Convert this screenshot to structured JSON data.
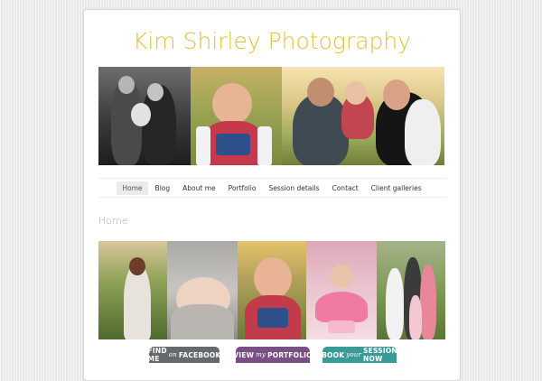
{
  "site": {
    "title": "Kim Shirley Photography"
  },
  "nav": {
    "items": [
      {
        "label": "Home",
        "active": true
      },
      {
        "label": "Blog",
        "active": false
      },
      {
        "label": "About me",
        "active": false
      },
      {
        "label": "Portfolio",
        "active": false
      },
      {
        "label": "Session details",
        "active": false
      },
      {
        "label": "Contact",
        "active": false
      },
      {
        "label": "Client galleries",
        "active": false
      }
    ]
  },
  "main": {
    "heading": "Home"
  },
  "cta": {
    "facebook": {
      "pre": "FIND ME",
      "mid": "on",
      "post": "FACEBOOK"
    },
    "portfolio": {
      "pre": "VIEW",
      "mid": "my",
      "post": "PORTFOLIO"
    },
    "session": {
      "pre": "BOOK",
      "mid": "your",
      "post": "SESSION NOW"
    }
  },
  "colors": {
    "title": "#e0c238",
    "facebook_button": "#666a6d",
    "portfolio_button": "#7a4f86",
    "session_button": "#3a9a98"
  }
}
